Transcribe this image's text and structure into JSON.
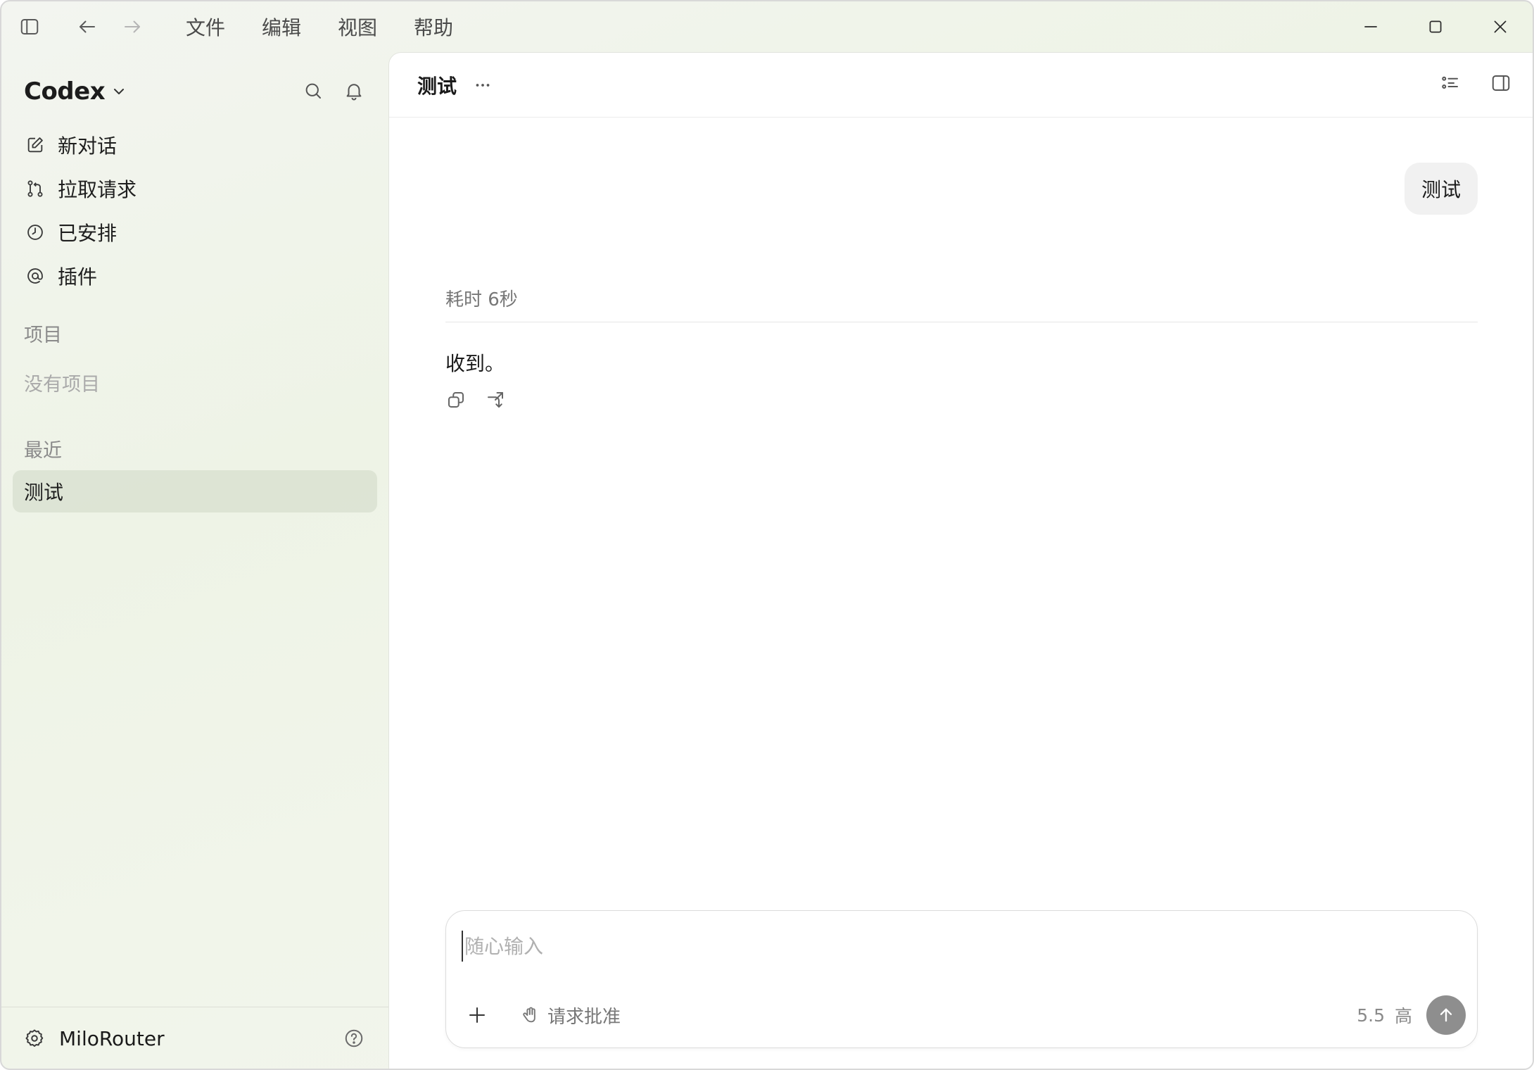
{
  "titlebar": {
    "menus": [
      "文件",
      "编辑",
      "视图",
      "帮助"
    ],
    "icons": [
      "sidebar-toggle-icon",
      "arrow-left-icon",
      "arrow-right-icon"
    ],
    "window_controls": [
      "minimize-icon",
      "maximize-icon",
      "close-icon"
    ]
  },
  "sidebar": {
    "app_title": "Codex",
    "nav": [
      {
        "label": "新对话",
        "icon": "edit-icon"
      },
      {
        "label": "拉取请求",
        "icon": "pull-request-icon"
      },
      {
        "label": "已安排",
        "icon": "clock-icon"
      },
      {
        "label": "插件",
        "icon": "at-icon"
      }
    ],
    "projects_title": "项目",
    "projects_empty": "没有项目",
    "recent_title": "最近",
    "recent": [
      {
        "label": "测试"
      }
    ],
    "footer_user": "MiloRouter"
  },
  "main": {
    "title": "测试",
    "user_message": "测试",
    "elapsed": "耗时 6秒",
    "reply": "收到。",
    "composer": {
      "placeholder": "随心输入",
      "approval_label": "请求批准",
      "model_version": "5.5",
      "model_level": "高"
    }
  },
  "colors": {
    "sidebar_bg": "#eef3e6",
    "send_button": "#8e8e8e",
    "selected_item": "#dde3d4"
  }
}
